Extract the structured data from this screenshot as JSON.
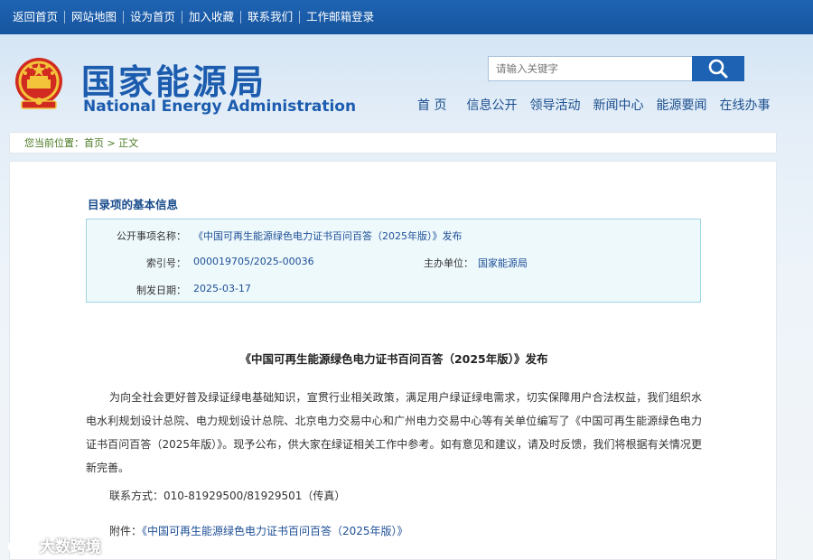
{
  "topbar": {
    "links": [
      "返回首页",
      "网站地图",
      "设为首页",
      "加入收藏",
      "联系我们",
      "工作邮箱登录"
    ]
  },
  "header": {
    "title_cn": "国家能源局",
    "title_en": "National Energy Administration",
    "emblem_icon": "national-emblem-icon"
  },
  "search": {
    "placeholder": "请输入关键字",
    "button_icon": "search-icon"
  },
  "nav": {
    "items": [
      "首 页",
      "信息公开",
      "领导活动",
      "新闻中心",
      "能源要闻",
      "在线办事"
    ]
  },
  "breadcrumb": {
    "prefix": "您当前位置：",
    "home": "首页",
    "sep": " > ",
    "current": "正文"
  },
  "info": {
    "title": "目录项的基本信息",
    "item_name_label": "公开事项名称：",
    "item_name": "《中国可再生能源绿色电力证书百问百答（2025年版）》发布",
    "index_label": "索引号：",
    "index": "000019705/2025-00036",
    "org_label": "主办单位：",
    "org": "国家能源局",
    "date_label": "制发日期：",
    "date": "2025-03-17"
  },
  "article": {
    "title": "《中国可再生能源绿色电力证书百问百答（2025年版）》发布",
    "body": "为向全社会更好普及绿证绿电基础知识，宣贯行业相关政策，满足用户绿证绿电需求，切实保障用户合法权益，我们组织水电水利规划设计总院、电力规划设计总院、北京电力交易中心和广州电力交易中心等有关单位编写了《中国可再生能源绿色电力证书百问百答（2025年版）》。现予公布，供大家在绿证相关工作中参考。如有意见和建议，请及时反馈，我们将根据有关情况更新完善。",
    "contact": "联系方式：010-81929500/81929501（传真）",
    "attach_label": "附件：",
    "attach_link": "《中国可再生能源绿色电力证书百问百答（2025年版）》"
  },
  "watermark": "大数跨境",
  "colors": {
    "brand": "#1c5cae",
    "topbar": "#1e63b3",
    "link": "#1e4f96",
    "crumb": "#4b7a24"
  }
}
